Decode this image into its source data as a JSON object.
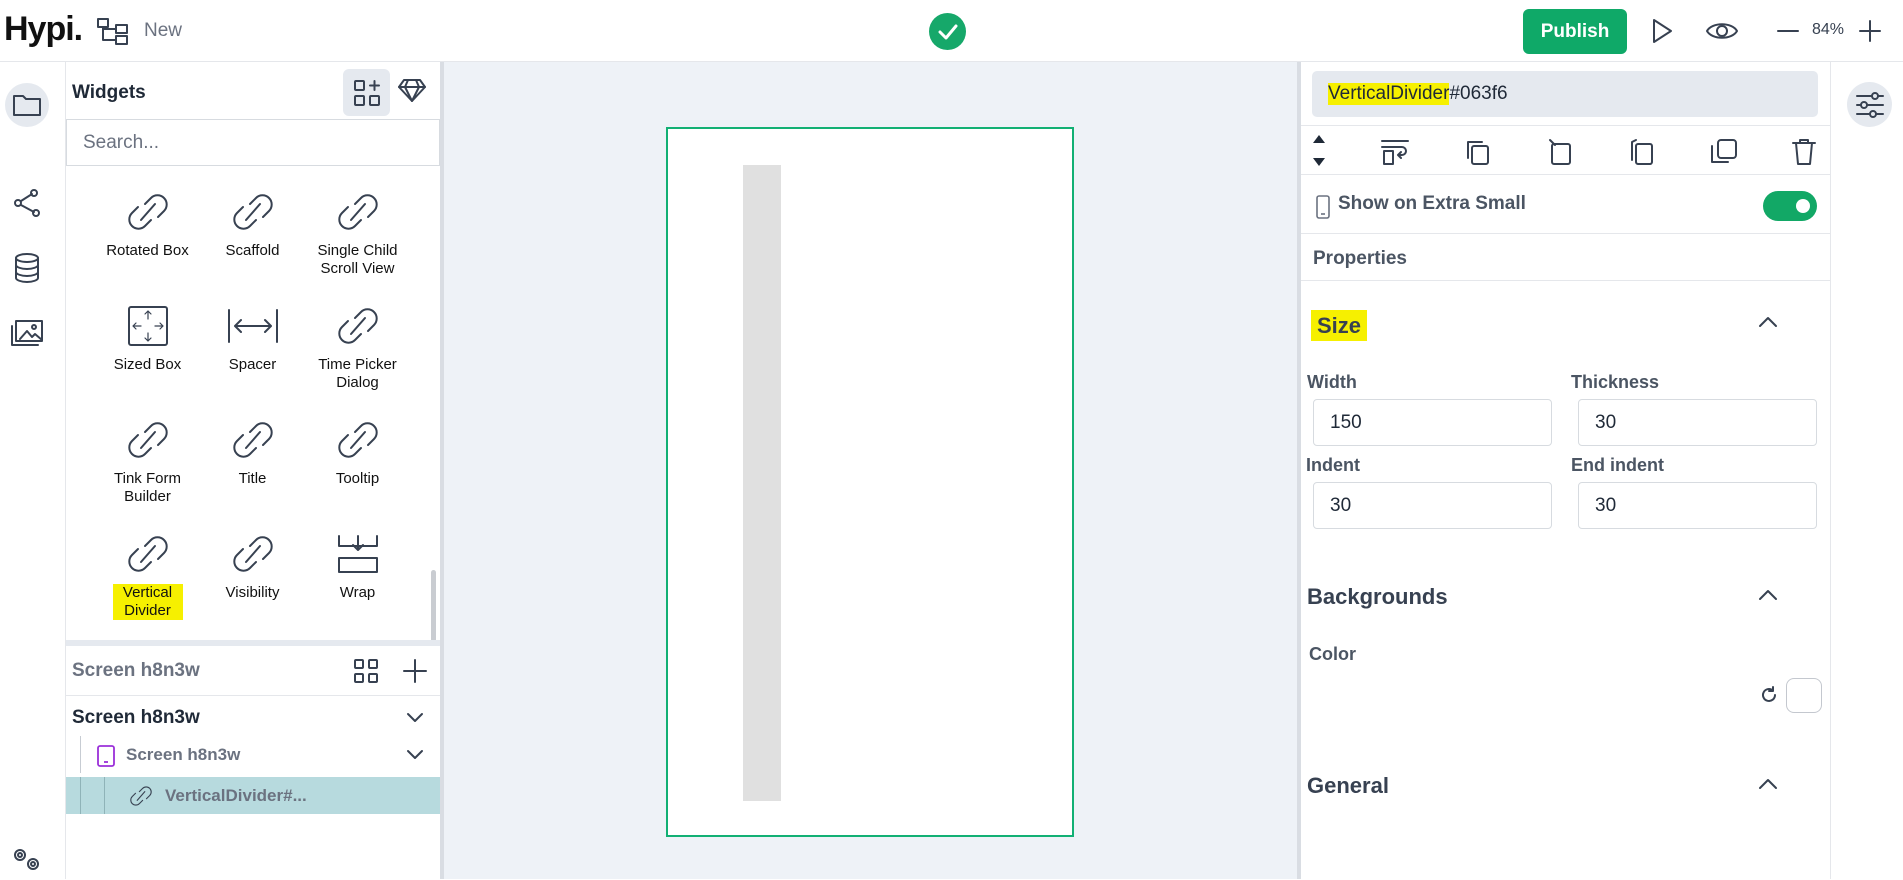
{
  "topbar": {
    "logo": "Hypi.",
    "new_label": "New",
    "publish_label": "Publish",
    "zoom": "84%"
  },
  "widgets": {
    "title": "Widgets",
    "search_placeholder": "Search...",
    "items": [
      {
        "label": "Rotated Box",
        "icon": "link-icon"
      },
      {
        "label": "Scaffold",
        "icon": "link-icon"
      },
      {
        "label": "Single Child Scroll View",
        "icon": "link-icon"
      },
      {
        "label": "Sized Box",
        "icon": "sized-box-icon"
      },
      {
        "label": "Spacer",
        "icon": "spacer-icon"
      },
      {
        "label": "Time Picker Dialog",
        "icon": "link-icon"
      },
      {
        "label": "Tink Form Builder",
        "icon": "link-icon"
      },
      {
        "label": "Title",
        "icon": "link-icon"
      },
      {
        "label": "Tooltip",
        "icon": "link-icon"
      },
      {
        "label": "Vertical Divider",
        "icon": "link-icon",
        "highlighted": true
      },
      {
        "label": "Visibility",
        "icon": "link-icon"
      },
      {
        "label": "Wrap",
        "icon": "wrap-icon"
      }
    ]
  },
  "tree": {
    "header": "Screen h8n3w",
    "nodes": [
      {
        "label": "Screen h8n3w",
        "level": 0
      },
      {
        "label": "Screen h8n3w",
        "level": 1
      },
      {
        "label": "VerticalDivider#...",
        "level": 2,
        "selected": true
      }
    ]
  },
  "properties": {
    "selected_name_highlight": "VerticalDivider",
    "selected_name_rest": "#063f6",
    "show_on_label": "Show on Extra Small",
    "show_on_enabled": true,
    "properties_title": "Properties",
    "size": {
      "title": "Size",
      "width_label": "Width",
      "width": "150",
      "thickness_label": "Thickness",
      "thickness": "30",
      "indent_label": "Indent",
      "indent": "30",
      "end_indent_label": "End indent",
      "end_indent": "30"
    },
    "backgrounds": {
      "title": "Backgrounds",
      "color_label": "Color",
      "color": "#ffffff"
    },
    "general": {
      "title": "General"
    }
  },
  "colors": {
    "accent": "#0fa968",
    "selection_border": "#12b074",
    "highlight": "#f6f000",
    "tree_selected": "#b7dade"
  }
}
